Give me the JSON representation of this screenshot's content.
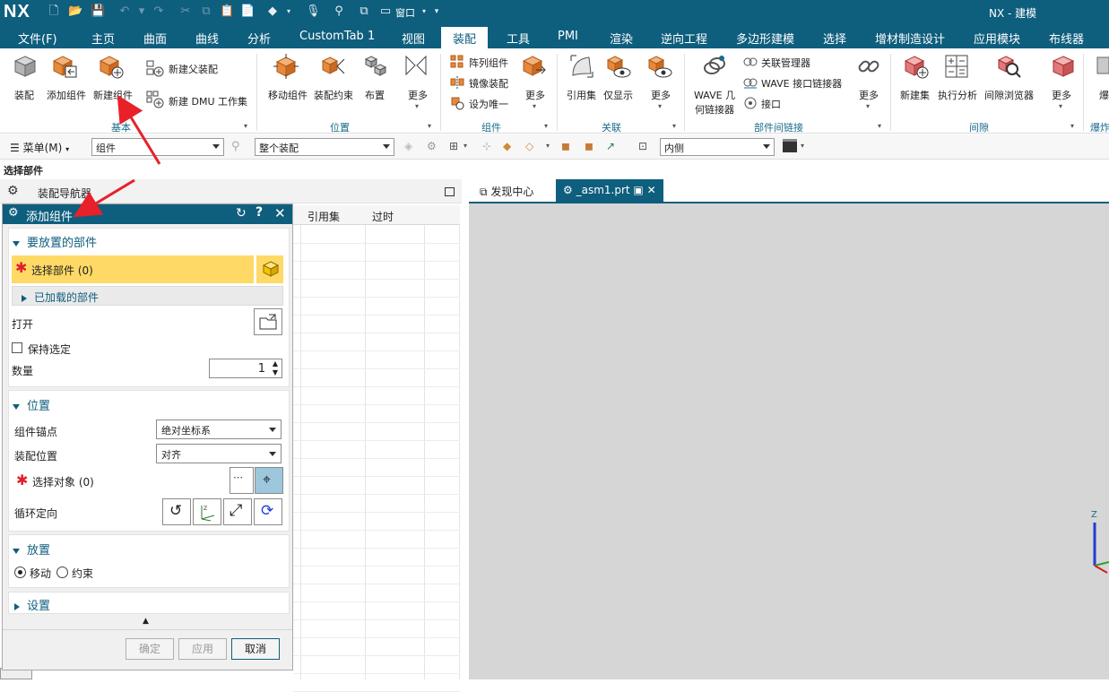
{
  "app": {
    "logo": "NX",
    "window_title": "NX - 建模",
    "window_menu": "窗口"
  },
  "menubar": {
    "tabs": [
      "文件(F)",
      "主页",
      "曲面",
      "曲线",
      "分析",
      "CustomTab 1",
      "视图",
      "装配",
      "工具",
      "PMI",
      "渲染",
      "逆向工程",
      "多边形建模",
      "选择",
      "增材制造设计",
      "应用模块",
      "布线器"
    ],
    "active": "装配"
  },
  "ribbon": {
    "groups": {
      "basic": "基本",
      "position": "位置",
      "component": "组件",
      "related": "关联",
      "inter_part": "部件间链接",
      "clearance": "间隙",
      "explode": "爆炸"
    },
    "basic": {
      "assemble": "装配",
      "add_component": "添加组件",
      "new_component": "新建组件",
      "new_parent": "新建父装配",
      "new_dmu": "新建 DMU 工作集"
    },
    "position": {
      "move_component": "移动组件",
      "assembly_constraint": "装配约束",
      "arrange": "布置",
      "more": "更多"
    },
    "component": {
      "array": "阵列组件",
      "mirror": "镜像装配",
      "make_unique": "设为唯一",
      "more": "更多"
    },
    "related": {
      "reference_set": "引用集",
      "show_only": "仅显示",
      "more": "更多"
    },
    "inter_part": {
      "wave_line1": "WAVE 几",
      "wave_line2": "何链接器",
      "relation_manager": "关联管理器",
      "wave_interface": "WAVE 接口链接器",
      "interface": "接口",
      "more": "更多"
    },
    "clearance": {
      "new_set": "新建集",
      "perform_analysis": "执行分析",
      "clearance_browser": "间隙浏览器",
      "more": "更多"
    },
    "explode_label": "爆"
  },
  "toolbar2": {
    "menu": "菜单(M)",
    "filter": "组件",
    "scope": "整个装配",
    "reference": "内侧"
  },
  "select_part_label": "选择部件",
  "nav": {
    "title": "装配导航器",
    "col_refset": "引用集",
    "col_stale": "过时"
  },
  "doctabs": {
    "discover": "发现中心",
    "asm": "_asm1.prt"
  },
  "dialog": {
    "title": "添加组件",
    "sec_parts": "要放置的部件",
    "select_part": "选择部件 (0)",
    "loaded_parts": "已加载的部件",
    "open": "打开",
    "keep_selected": "保持选定",
    "quantity_label": "数量",
    "quantity_value": "1",
    "sec_position": "位置",
    "anchor_label": "组件锚点",
    "anchor_value": "绝对坐标系",
    "asm_pos_label": "装配位置",
    "asm_pos_value": "对齐",
    "select_object": "选择对象 (0)",
    "cycle_orient": "循环定向",
    "sec_placement": "放置",
    "move": "移动",
    "constraint": "约束",
    "sec_settings": "设置",
    "ok": "确定",
    "apply": "应用",
    "cancel": "取消"
  },
  "colors": {
    "brand": "#0e5e7d",
    "highlight": "#ffd966",
    "required": "#e0202a",
    "arrow": "#e8202a"
  }
}
